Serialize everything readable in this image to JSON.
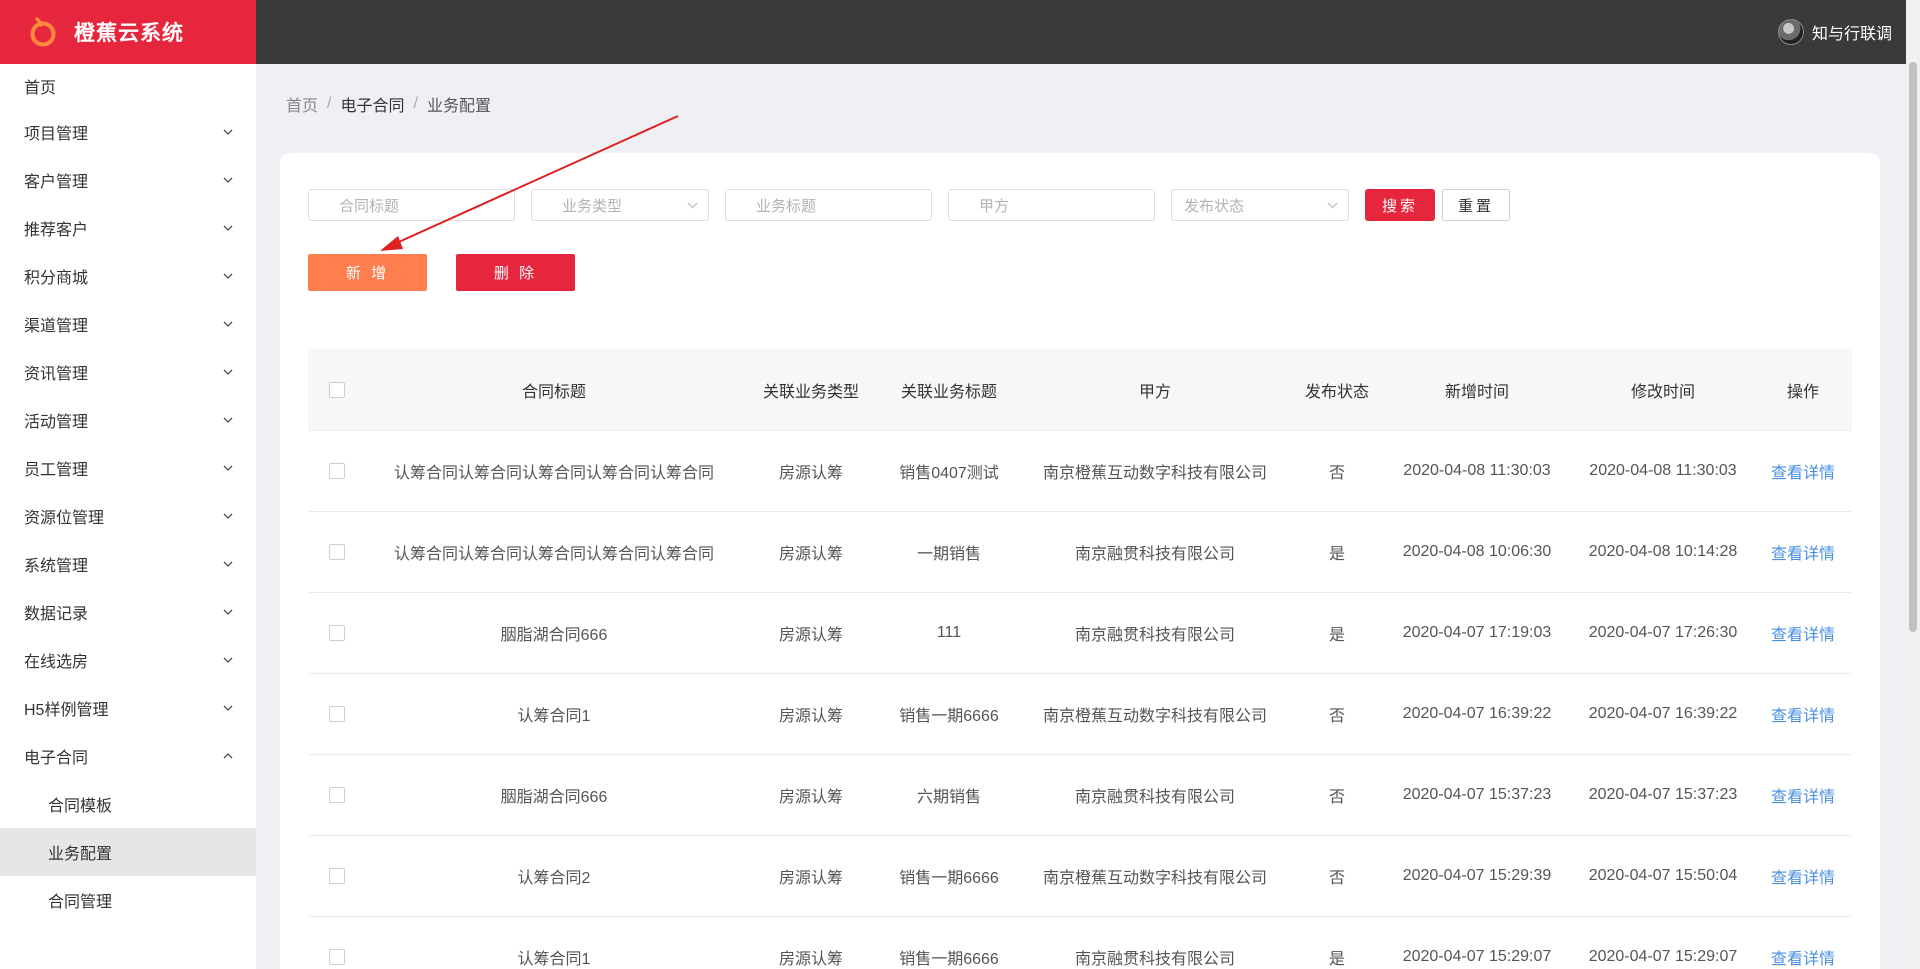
{
  "app": {
    "title": "橙蕉云系统",
    "brand_color": "#e6263d"
  },
  "user": {
    "name": "知与行联调"
  },
  "sidebar": {
    "items": [
      {
        "label": "首页"
      },
      {
        "label": "项目管理"
      },
      {
        "label": "客户管理"
      },
      {
        "label": "推荐客户"
      },
      {
        "label": "积分商城"
      },
      {
        "label": "渠道管理"
      },
      {
        "label": "资讯管理"
      },
      {
        "label": "活动管理"
      },
      {
        "label": "员工管理"
      },
      {
        "label": "资源位管理"
      },
      {
        "label": "系统管理"
      },
      {
        "label": "数据记录"
      },
      {
        "label": "在线选房"
      },
      {
        "label": "H5样例管理"
      },
      {
        "label": "电子合同"
      }
    ],
    "sub_items": [
      {
        "label": "合同模板"
      },
      {
        "label": "业务配置"
      },
      {
        "label": "合同管理"
      }
    ]
  },
  "breadcrumb": {
    "home": "首页",
    "mid": "电子合同",
    "current": "业务配置",
    "sep": "/"
  },
  "filters": {
    "contract_title_placeholder": "合同标题",
    "business_type_placeholder": "业务类型",
    "business_title_placeholder": "业务标题",
    "party_a_placeholder": "甲方",
    "publish_status_placeholder": "发布状态",
    "search_label": "搜索",
    "reset_label": "重置"
  },
  "actions": {
    "add_label": "新 增",
    "delete_label": "删 除"
  },
  "table": {
    "headers": [
      "合同标题",
      "关联业务类型",
      "关联业务标题",
      "甲方",
      "发布状态",
      "新增时间",
      "修改时间",
      "操作"
    ],
    "rows": [
      {
        "title": "认筹合同认筹合同认筹合同认筹合同认筹合同",
        "type": "房源认筹",
        "biz": "销售0407测试",
        "party": "南京橙蕉互动数字科技有限公司",
        "status": "否",
        "created": "2020-04-08 11:30:03",
        "modified": "2020-04-08 11:30:03",
        "op": "查看详情"
      },
      {
        "title": "认筹合同认筹合同认筹合同认筹合同认筹合同",
        "type": "房源认筹",
        "biz": "一期销售",
        "party": "南京融贯科技有限公司",
        "status": "是",
        "created": "2020-04-08 10:06:30",
        "modified": "2020-04-08 10:14:28",
        "op": "查看详情"
      },
      {
        "title": "胭脂湖合同666",
        "type": "房源认筹",
        "biz": "111",
        "party": "南京融贯科技有限公司",
        "status": "是",
        "created": "2020-04-07 17:19:03",
        "modified": "2020-04-07 17:26:30",
        "op": "查看详情"
      },
      {
        "title": "认筹合同1",
        "type": "房源认筹",
        "biz": "销售一期6666",
        "party": "南京橙蕉互动数字科技有限公司",
        "status": "否",
        "created": "2020-04-07 16:39:22",
        "modified": "2020-04-07 16:39:22",
        "op": "查看详情"
      },
      {
        "title": "胭脂湖合同666",
        "type": "房源认筹",
        "biz": "六期销售",
        "party": "南京融贯科技有限公司",
        "status": "否",
        "created": "2020-04-07 15:37:23",
        "modified": "2020-04-07 15:37:23",
        "op": "查看详情"
      },
      {
        "title": "认筹合同2",
        "type": "房源认筹",
        "biz": "销售一期6666",
        "party": "南京橙蕉互动数字科技有限公司",
        "status": "否",
        "created": "2020-04-07 15:29:39",
        "modified": "2020-04-07 15:50:04",
        "op": "查看详情"
      },
      {
        "title": "认筹合同1",
        "type": "房源认筹",
        "biz": "销售一期6666",
        "party": "南京融贯科技有限公司",
        "status": "是",
        "created": "2020-04-07 15:29:07",
        "modified": "2020-04-07 15:29:07",
        "op": "查看详情"
      }
    ]
  }
}
